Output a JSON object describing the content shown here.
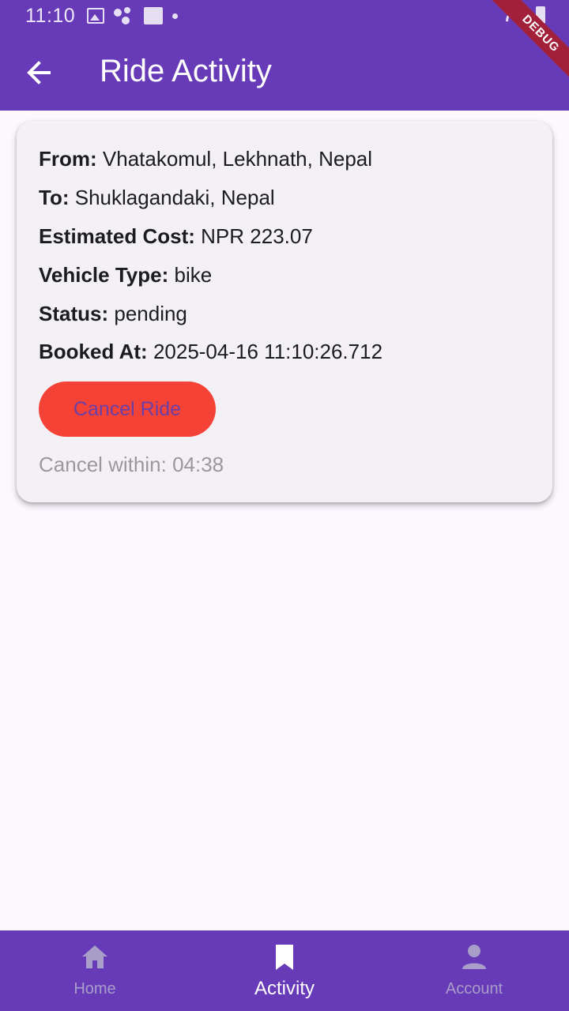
{
  "status_bar": {
    "time": "11:10",
    "icons": [
      "image-icon",
      "assistant-dots-icon",
      "app-box-icon",
      "notification-dot-icon",
      "wifi-icon",
      "battery-icon"
    ]
  },
  "debug_ribbon": "DEBUG",
  "app_bar": {
    "title": "Ride Activity",
    "back_icon": "arrow-back-icon"
  },
  "ride": {
    "from_label": "From:",
    "from_value": "Vhatakomul, Lekhnath, Nepal",
    "to_label": "To:",
    "to_value": "Shuklagandaki, Nepal",
    "cost_label": "Estimated Cost:",
    "cost_value": "NPR 223.07",
    "vehicle_label": "Vehicle Type:",
    "vehicle_value": "bike",
    "status_label": "Status:",
    "status_value": "pending",
    "booked_label": "Booked At:",
    "booked_value": "2025-04-16 11:10:26.712",
    "cancel_button": "Cancel Ride",
    "cancel_timer": "Cancel within: 04:38"
  },
  "bottom_nav": {
    "items": [
      {
        "label": "Home",
        "icon": "home-icon",
        "active": false
      },
      {
        "label": "Activity",
        "icon": "bookmark-icon",
        "active": true
      },
      {
        "label": "Account",
        "icon": "person-icon",
        "active": false
      }
    ]
  },
  "colors": {
    "primary": "#673ab7",
    "background": "#fdf7fe",
    "card": "#f4f1f6",
    "cancel_button": "#f44336",
    "debug_ribbon": "#a3203a"
  }
}
